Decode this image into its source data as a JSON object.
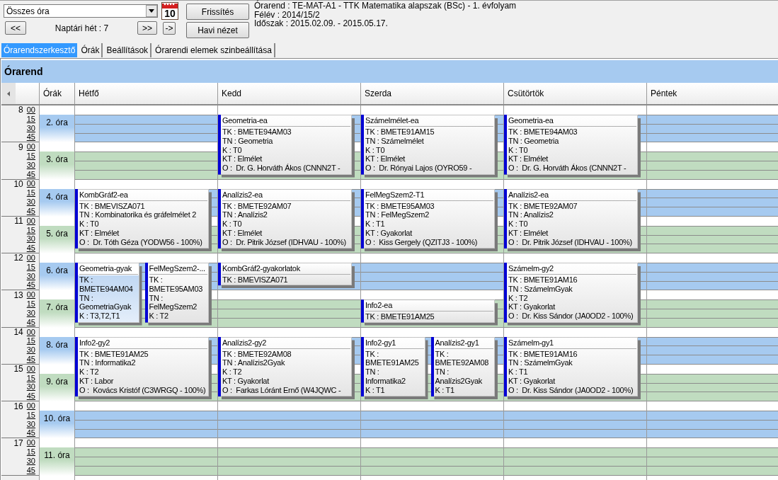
{
  "toolbar": {
    "filter": {
      "value": "Összes óra"
    },
    "calendar_day": "10",
    "prev_week": "<<",
    "week_label": "Naptári hét : 7",
    "next_week": ">>",
    "go": "->",
    "refresh": "Frissítés",
    "month_view": "Havi nézet"
  },
  "info": [
    "Órarend : TE-MAT-A1 - TTK Matematika alapszak (BSc) - 1. évfolyam",
    "Félév : 2014/15/2",
    "Időszak : 2015.02.09. - 2015.05.17."
  ],
  "tabs": [
    {
      "label": "Órarendszerkesztő",
      "selected": true
    },
    {
      "label": "Órák",
      "selected": false
    },
    {
      "label": "Beállítások",
      "selected": false
    },
    {
      "label": "Órarendi elemek szinbeállítása",
      "selected": false
    }
  ],
  "timetable": {
    "title": "Órarend",
    "periods_heading": "Órák",
    "days": [
      {
        "name": "Hétfő",
        "slots": [
          {
            "color": "#a6caf0"
          },
          {
            "color": "#c0dcc0"
          },
          {
            "color": "#a6caf0",
            "events": [
              {
                "kind": "double",
                "title": "KombGráf2-ea",
                "selected": false,
                "lines": [
                  "TK : BMEVISZA071",
                  "TN : Kombinatorika és gráfelmélet 2",
                  "K : T0",
                  "KT : Elmélet",
                  "O :  Dr. Tóth Géza (YODW56 - 100%)"
                ]
              }
            ]
          },
          {
            "color": "#c0dcc0"
          },
          {
            "color": "#a6caf0",
            "events": [
              {
                "kind": "double",
                "title": "Geometria-gyak",
                "selected": true,
                "lines": [
                  "TK : BMETE94AM04",
                  "TN : GeometriaGyak",
                  "K : T3,T2,T1"
                ]
              },
              {
                "kind": "double",
                "title": "FelMegSzem2-...",
                "selected": false,
                "lines": [
                  "TK : BMETE95AM03",
                  "TN : FelMegSzem2",
                  "K : T2"
                ]
              }
            ]
          },
          {
            "color": "#c0dcc0"
          },
          {
            "color": "#a6caf0",
            "events": [
              {
                "kind": "double",
                "title": "Info2-gy2",
                "selected": false,
                "lines": [
                  "TK : BMETE91AM25",
                  "TN : Informatika2",
                  "K : T2",
                  "KT : Labor",
                  "O :  Kovács Kristóf (C3WRGQ - 100%)"
                ]
              }
            ]
          },
          {
            "color": "#c0dcc0"
          },
          {
            "color": "#a6caf0"
          },
          {
            "color": "#c0dcc0"
          }
        ]
      },
      {
        "name": "Kedd",
        "slots": [
          {
            "color": "#a6caf0",
            "events": [
              {
                "kind": "double",
                "title": "Geometria-ea",
                "selected": false,
                "lines": [
                  "TK : BMETE94AM03",
                  "TN : Geometria",
                  "K : T0",
                  "KT : Elmélet",
                  "O :  Dr. G. Horváth Ákos (CNNN2T -"
                ]
              }
            ]
          },
          {
            "color": "#c0dcc0"
          },
          {
            "color": "#a6caf0",
            "events": [
              {
                "kind": "double",
                "title": "Analízis2-ea",
                "selected": false,
                "lines": [
                  "TK : BMETE92AM07",
                  "TN : Analízis2",
                  "K : T0",
                  "KT : Elmélet",
                  "O :  Dr. Pitrik József (IDHVAU - 100%)"
                ]
              }
            ]
          },
          {
            "color": "#c0dcc0"
          },
          {
            "color": "#a6caf0",
            "events": [
              {
                "kind": "single",
                "title": "KombGráf2-gyakorlatok",
                "selected": false,
                "lines": [
                  "TK : BMEVISZA071"
                ]
              }
            ]
          },
          {
            "color": "#c0dcc0"
          },
          {
            "color": "#a6caf0",
            "events": [
              {
                "kind": "double",
                "title": "Analízis2-gy2",
                "selected": false,
                "lines": [
                  "TK : BMETE92AM08",
                  "TN : Analízis2Gyak",
                  "K : T2",
                  "KT : Gyakorlat",
                  "O :  Farkas Lóránt Ernő (W4JQWC -"
                ]
              }
            ]
          },
          {
            "color": "#c0dcc0"
          },
          {
            "color": "#a6caf0"
          },
          {
            "color": "#c0dcc0"
          }
        ]
      },
      {
        "name": "Szerda",
        "slots": [
          {
            "color": "#a6caf0",
            "events": [
              {
                "kind": "double",
                "title": "Számelmélet-ea",
                "selected": false,
                "lines": [
                  "TK : BMETE91AM15",
                  "TN : Számelmélet",
                  "K : T0",
                  "KT : Elmélet",
                  "O :  Dr. Rónyai Lajos (OYRO59 -"
                ]
              }
            ]
          },
          {
            "color": "#c0dcc0"
          },
          {
            "color": "#a6caf0",
            "events": [
              {
                "kind": "double",
                "title": "FelMegSzem2-T1",
                "selected": false,
                "lines": [
                  "TK : BMETE95AM03",
                  "TN : FelMegSzem2",
                  "K : T1",
                  "KT : Gyakorlat",
                  "O :  Kiss Gergely (QZITJ3 - 100%)"
                ]
              }
            ]
          },
          {
            "color": "#c0dcc0"
          },
          {
            "color": "#a6caf0"
          },
          {
            "color": "#c0dcc0",
            "events": [
              {
                "kind": "single",
                "title": "Info2-ea",
                "selected": false,
                "lines": [
                  "TK : BMETE91AM25"
                ]
              }
            ]
          },
          {
            "color": "#a6caf0",
            "events": [
              {
                "kind": "double",
                "title": "Info2-gy1",
                "selected": false,
                "lines": [
                  "TK : BMETE91AM25",
                  "TN : Informatika2",
                  "K : T1"
                ]
              },
              {
                "kind": "double",
                "title": "Analízis2-gy1",
                "selected": false,
                "lines": [
                  "TK : BMETE92AM08",
                  "TN : Analízis2Gyak",
                  "K : T1"
                ]
              }
            ]
          },
          {
            "color": "#c0dcc0"
          },
          {
            "color": "#a6caf0"
          },
          {
            "color": "#c0dcc0"
          }
        ]
      },
      {
        "name": "Csütörtök",
        "slots": [
          {
            "color": "#a6caf0",
            "events": [
              {
                "kind": "double",
                "title": "Geometria-ea",
                "selected": false,
                "lines": [
                  "TK : BMETE94AM03",
                  "TN : Geometria",
                  "K : T0",
                  "KT : Elmélet",
                  "O :  Dr. G. Horváth Ákos (CNNN2T -"
                ]
              }
            ]
          },
          {
            "color": "#c0dcc0"
          },
          {
            "color": "#a6caf0",
            "events": [
              {
                "kind": "double",
                "title": "Analízis2-ea",
                "selected": false,
                "lines": [
                  "TK : BMETE92AM07",
                  "TN : Analízis2",
                  "K : T0",
                  "KT : Elmélet",
                  "O :  Dr. Pitrik József (IDHVAU - 100%)"
                ]
              }
            ]
          },
          {
            "color": "#c0dcc0"
          },
          {
            "color": "#a6caf0",
            "events": [
              {
                "kind": "double",
                "title": "Számelm-gy2",
                "selected": false,
                "lines": [
                  "TK : BMETE91AM16",
                  "TN : SzámelmGyak",
                  "K : T2",
                  "KT : Gyakorlat",
                  "O :  Dr. Kiss Sándor (JA0OD2 - 100%)"
                ]
              }
            ]
          },
          {
            "color": "#c0dcc0"
          },
          {
            "color": "#a6caf0",
            "events": [
              {
                "kind": "double",
                "title": "Számelm-gy1",
                "selected": false,
                "lines": [
                  "TK : BMETE91AM16",
                  "TN : SzámelmGyak",
                  "K : T1",
                  "KT : Gyakorlat",
                  "O :  Dr. Kiss Sándor (JA0OD2 - 100%)"
                ]
              }
            ]
          },
          {
            "color": "#c0dcc0"
          },
          {
            "color": "#a6caf0"
          },
          {
            "color": "#c0dcc0"
          }
        ]
      },
      {
        "name": "Péntek",
        "slots": [
          {
            "color": "#a6caf0"
          },
          {
            "color": "#c0dcc0"
          },
          {
            "color": "#a6caf0"
          },
          {
            "color": "#c0dcc0"
          },
          {
            "color": "#a6caf0"
          },
          {
            "color": "#c0dcc0"
          },
          {
            "color": "#a6caf0"
          },
          {
            "color": "#c0dcc0"
          },
          {
            "color": "#a6caf0"
          },
          {
            "color": "#c0dcc0"
          }
        ]
      }
    ],
    "hours": [
      {
        "hour": "8",
        "quarters": [
          "00",
          "15",
          "30",
          "45"
        ]
      },
      {
        "hour": "9",
        "quarters": [
          "00",
          "15",
          "30",
          "45"
        ]
      },
      {
        "hour": "10",
        "quarters": [
          "00",
          "15",
          "30",
          "45"
        ]
      },
      {
        "hour": "11",
        "quarters": [
          "00",
          "15",
          "30",
          "45"
        ]
      },
      {
        "hour": "12",
        "quarters": [
          "00",
          "15",
          "30",
          "45"
        ]
      },
      {
        "hour": "13",
        "quarters": [
          "00",
          "15",
          "30",
          "45"
        ]
      },
      {
        "hour": "14",
        "quarters": [
          "00",
          "15",
          "30",
          "45"
        ]
      },
      {
        "hour": "15",
        "quarters": [
          "00",
          "15",
          "30",
          "45"
        ]
      },
      {
        "hour": "16",
        "quarters": [
          "00",
          "15",
          "30",
          "45"
        ]
      },
      {
        "hour": "17",
        "quarters": [
          "00",
          "15",
          "30",
          "45"
        ]
      }
    ],
    "periods": [
      {
        "label": "2. óra",
        "color": "#a6caf0"
      },
      {
        "label": "3. óra",
        "color": "#c0dcc0"
      },
      {
        "label": "4. óra",
        "color": "#a6caf0"
      },
      {
        "label": "5. óra",
        "color": "#c0dcc0"
      },
      {
        "label": "6. óra",
        "color": "#a6caf0"
      },
      {
        "label": "7. óra",
        "color": "#c0dcc0"
      },
      {
        "label": "8. óra",
        "color": "#a6caf0"
      },
      {
        "label": "9. óra",
        "color": "#c0dcc0"
      },
      {
        "label": "10. óra",
        "color": "#a6caf0"
      },
      {
        "label": "11. óra",
        "color": "#c0dcc0"
      }
    ]
  }
}
